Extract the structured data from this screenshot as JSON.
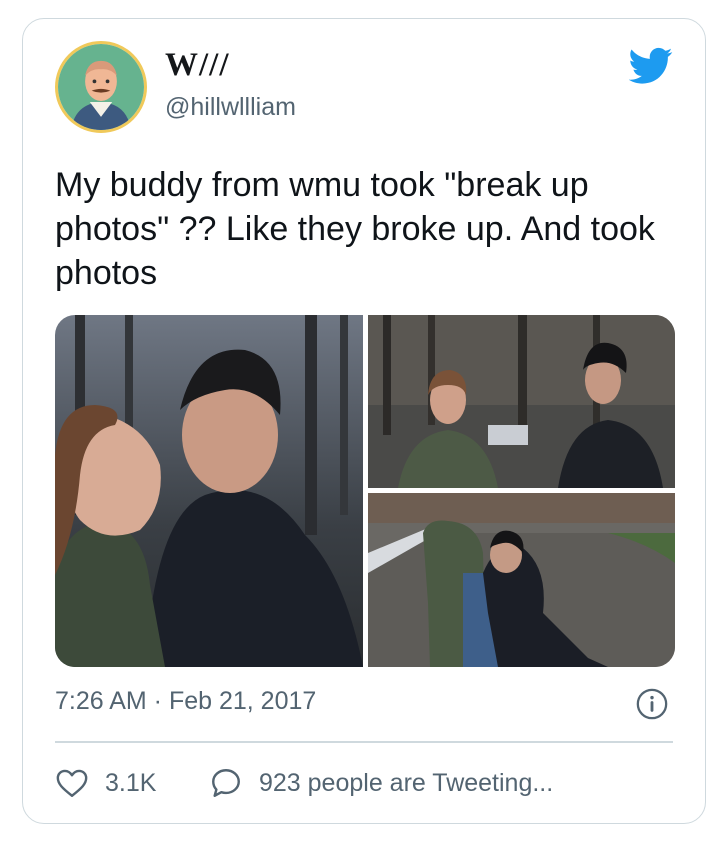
{
  "user": {
    "display_name": "W///",
    "handle": "@hillwllliam"
  },
  "tweet": {
    "text": "My buddy from wmu took \"break up photos\" ?? Like they broke up. And took photos",
    "timestamp": "7:26 AM · Feb 21, 2017"
  },
  "actions": {
    "like_count": "3.1K",
    "tweeting_label": "923 people are Tweeting..."
  },
  "colors": {
    "twitter_blue": "#1d9bf0",
    "muted_text": "#536471",
    "border": "#cfd9de"
  },
  "icons": {
    "logo": "twitter-bird-icon",
    "info": "info-icon",
    "like": "heart-icon",
    "reply": "speech-bubble-icon"
  }
}
